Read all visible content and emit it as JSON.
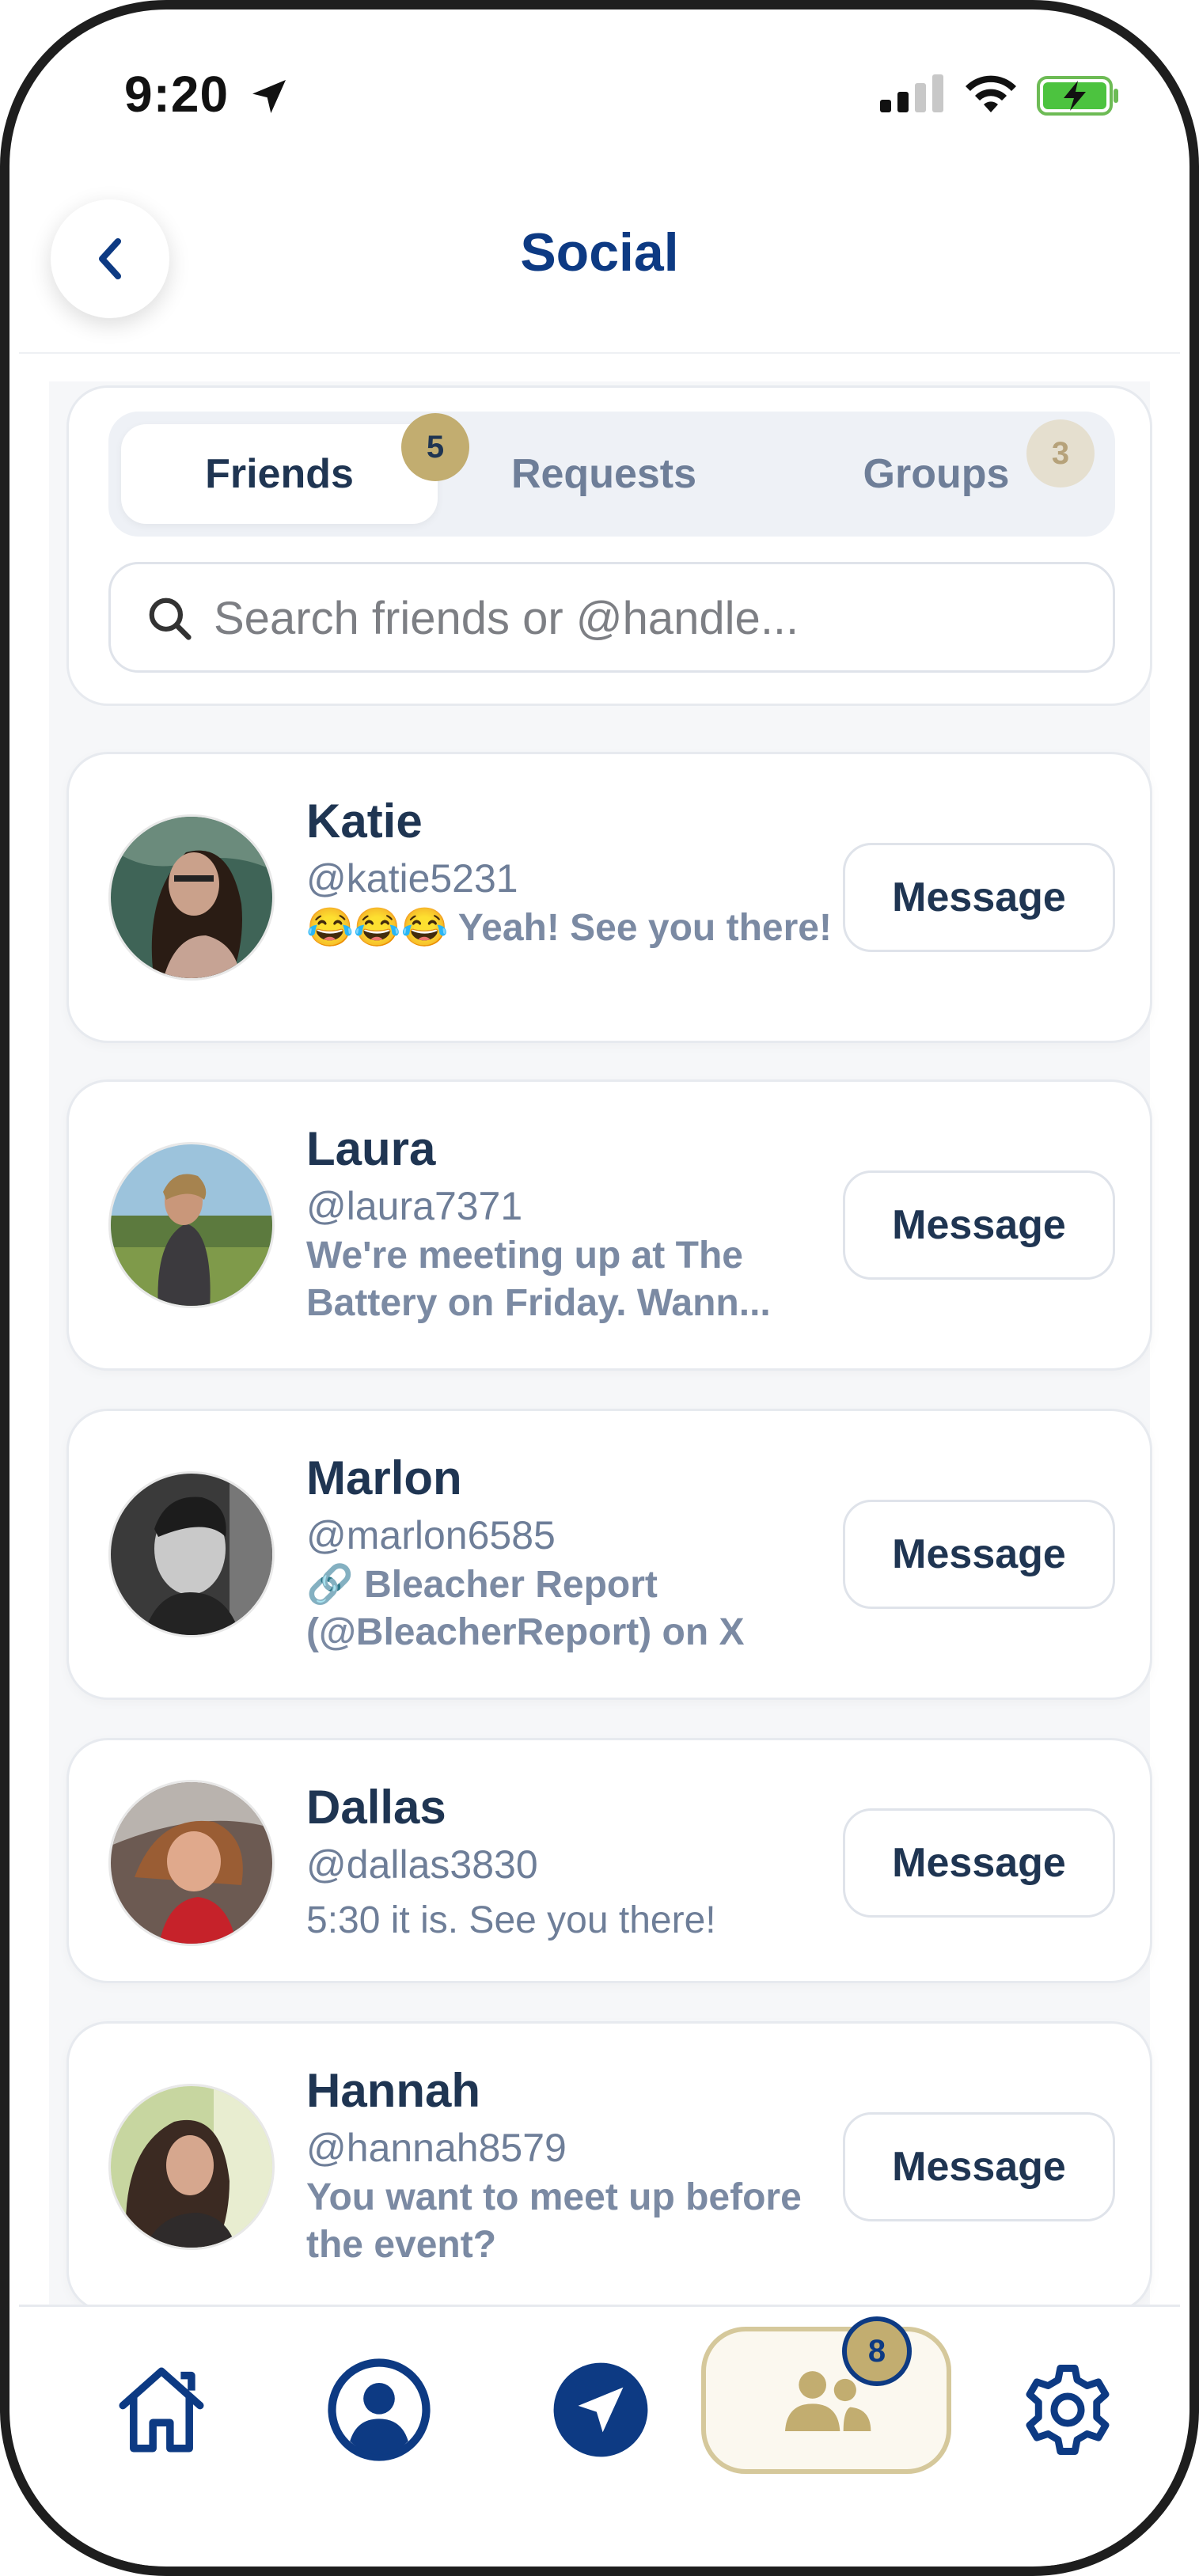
{
  "status_bar": {
    "time": "9:20"
  },
  "header": {
    "title": "Social"
  },
  "tabs": [
    {
      "label": "Friends",
      "badge": "5",
      "active": true
    },
    {
      "label": "Requests",
      "badge": "",
      "active": false
    },
    {
      "label": "Groups",
      "badge": "3",
      "active": false
    }
  ],
  "search": {
    "placeholder": "Search friends or @handle..."
  },
  "friends": [
    {
      "name": "Katie",
      "handle": "@katie5231",
      "last_message": "😂😂😂 Yeah! See you there!",
      "button": "Message"
    },
    {
      "name": "Laura",
      "handle": "@laura7371",
      "last_message": "We're meeting up at The Battery on Friday. Wann...",
      "button": "Message"
    },
    {
      "name": "Marlon",
      "handle": "@marlon6585",
      "last_message": "🔗 Bleacher Report (@BleacherReport) on X",
      "button": "Message"
    },
    {
      "name": "Dallas",
      "handle": "@dallas3830",
      "last_message": "5:30 it is. See you there!",
      "button": "Message"
    },
    {
      "name": "Hannah",
      "handle": "@hannah8579",
      "last_message": "You want to meet up before the event?",
      "button": "Message"
    }
  ],
  "bottom_nav": {
    "items": [
      "home-icon",
      "profile-icon",
      "navigate-icon",
      "social-icon",
      "settings-icon"
    ],
    "social_badge": "8"
  },
  "colors": {
    "brand": "#0d3a83",
    "accent_gold": "#c2ad70",
    "text_dark": "#1f3552",
    "text_muted": "#6e7e98"
  }
}
